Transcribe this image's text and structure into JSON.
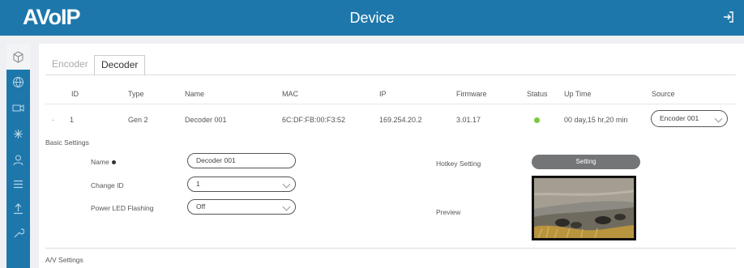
{
  "header": {
    "logo": "AVoIP",
    "title": "Device"
  },
  "tabs": [
    {
      "label": "Encoder"
    },
    {
      "label": "Decoder"
    }
  ],
  "table": {
    "headers": [
      "ID",
      "Type",
      "Name",
      "MAC",
      "IP",
      "Firmware",
      "Status",
      "Up Time",
      "Source"
    ],
    "row": {
      "expander": "-",
      "id": "1",
      "type": "Gen 2",
      "name": "Decoder 001",
      "mac": "6C:DF:FB:00:F3:52",
      "ip": "169.254.20.2",
      "firmware": "3.01.17",
      "status_color": "#7cc63c",
      "uptime": "00 day,15 hr,20 min",
      "source": "Encoder 001"
    }
  },
  "basic_settings": {
    "section_title": "Basic Settings",
    "name_label": "Name",
    "name_value": "Decoder 001",
    "change_id_label": "Change ID",
    "change_id_value": "1",
    "power_led_label": "Power LED Flashing",
    "power_led_value": "Off",
    "hotkey_label": "Hotkey Setting",
    "hotkey_button": "Setting",
    "preview_label": "Preview"
  },
  "av_settings": {
    "section_title": "A/V Settings"
  },
  "colors": {
    "header": "#1d77ab",
    "sidebar": "#1d77ab",
    "button": "#737577"
  },
  "sidebar_icons": [
    "cube-icon",
    "globe-icon",
    "video-icon",
    "network-icon",
    "user-icon",
    "list-icon",
    "upload-icon",
    "wrench-icon"
  ]
}
